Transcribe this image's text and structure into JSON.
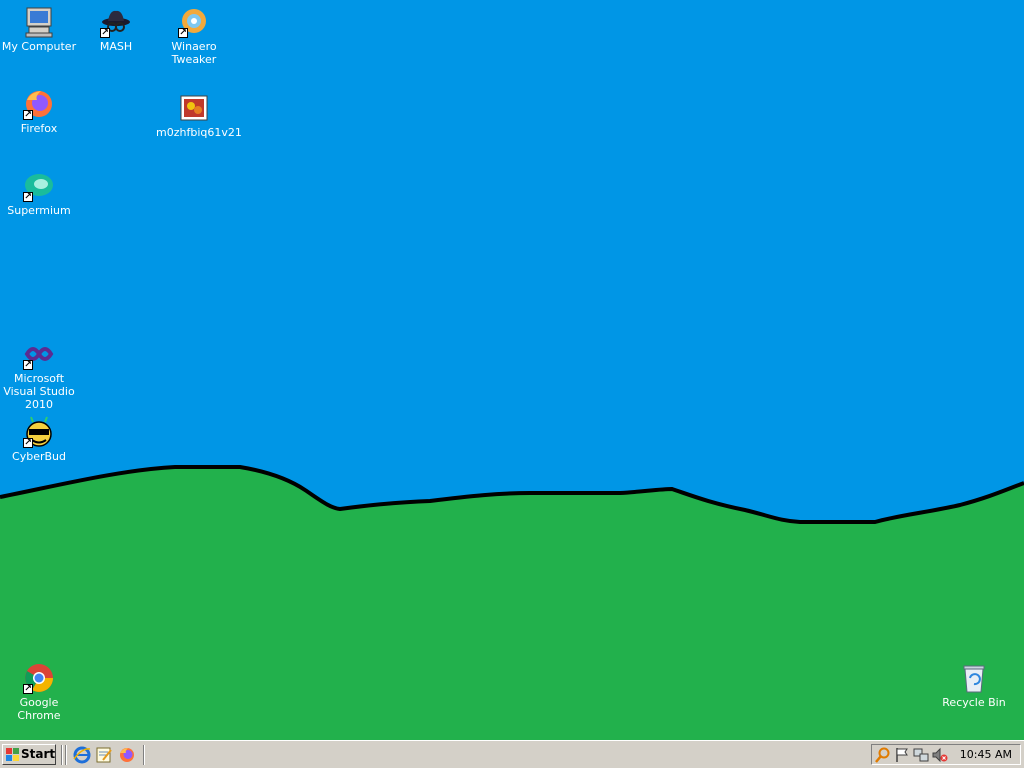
{
  "desktop": {
    "background_color": "#0096e6",
    "hill_color": "#22b14c",
    "icons": [
      {
        "label": "My Computer",
        "icon": "computer-icon"
      },
      {
        "label": "MASH",
        "icon": "spy-hat-icon"
      },
      {
        "label": "Winaero Tweaker",
        "icon": "winaero-icon"
      },
      {
        "label": "Firefox",
        "icon": "firefox-icon"
      },
      {
        "label": "m0zhfbiq61v21",
        "icon": "picture-file-icon"
      },
      {
        "label": "Supermium",
        "icon": "supermium-icon"
      },
      {
        "label": "Microsoft Visual Studio 2010",
        "icon": "visual-studio-icon"
      },
      {
        "label": "CyberBud",
        "icon": "cyberbud-icon"
      },
      {
        "label": "Google Chrome",
        "icon": "chrome-icon"
      },
      {
        "label": "Recycle Bin",
        "icon": "recycle-bin-icon"
      }
    ]
  },
  "taskbar": {
    "start_label": "Start",
    "quick_launch": [
      "internet-explorer-icon",
      "notepad-icon",
      "firefox-icon"
    ],
    "tray_icons": [
      "search-icon",
      "flag-icon",
      "network-icon",
      "volume-muted-icon"
    ],
    "clock": "10:45 AM"
  }
}
